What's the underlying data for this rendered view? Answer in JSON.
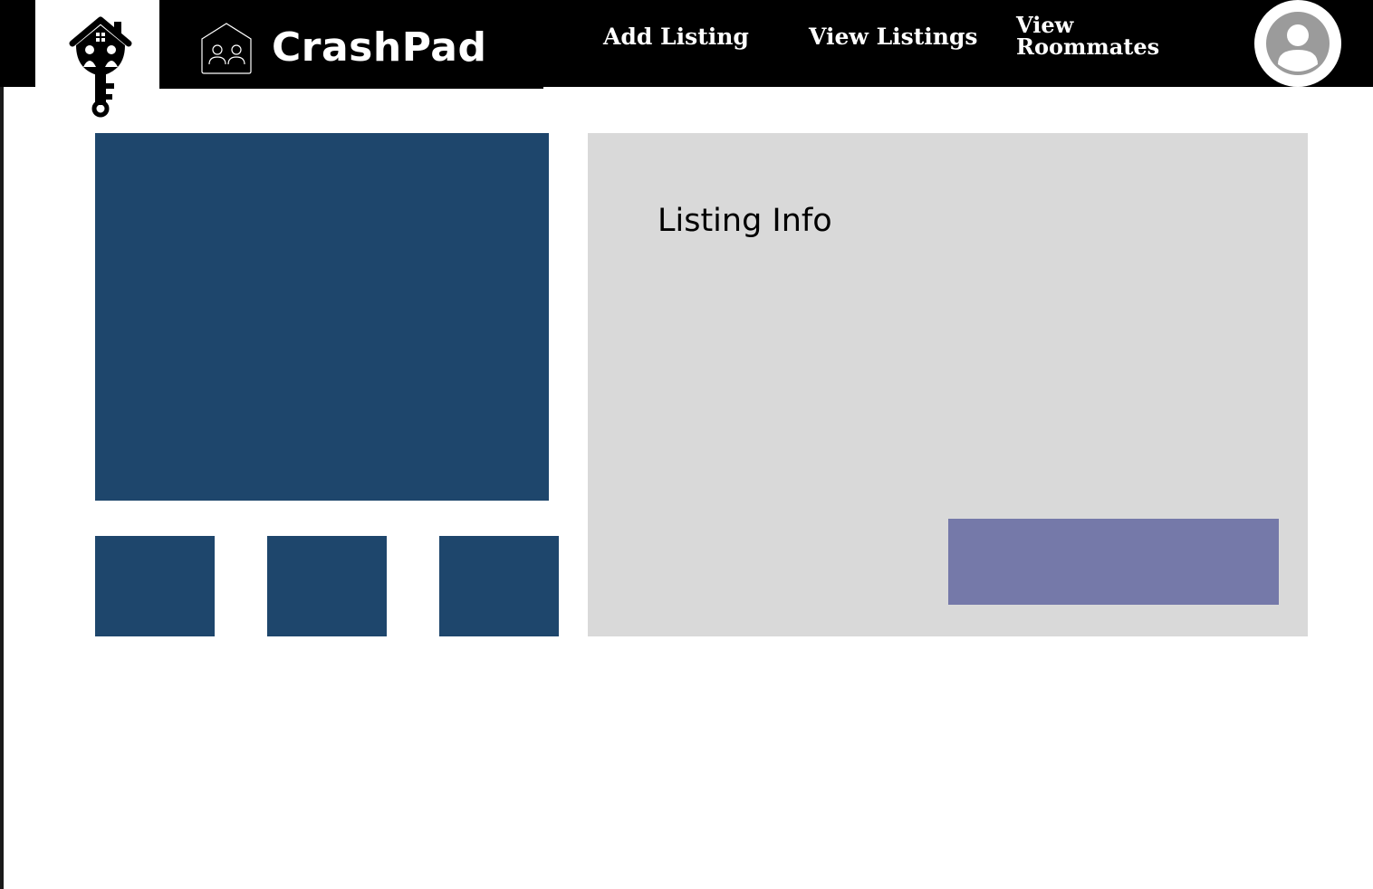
{
  "app": {
    "brand_name": "CrashPad",
    "logo_icon": "house-key-logo-icon",
    "brand_icon": "house-people-icon"
  },
  "nav": {
    "items": [
      {
        "label": "Add Listing"
      },
      {
        "label": "View Listings"
      },
      {
        "label": "View Roommates"
      }
    ],
    "profile_icon": "user-avatar-icon"
  },
  "gallery": {
    "thumbnail_count": 3
  },
  "listing": {
    "info_title": "Listing Info",
    "action_button_label": ""
  },
  "colors": {
    "navbar": "#000000",
    "photo_placeholder": "#1e466c",
    "info_panel": "#d9d9d9",
    "action_button": "#7579a9",
    "avatar_gray": "#9b9b9b"
  }
}
